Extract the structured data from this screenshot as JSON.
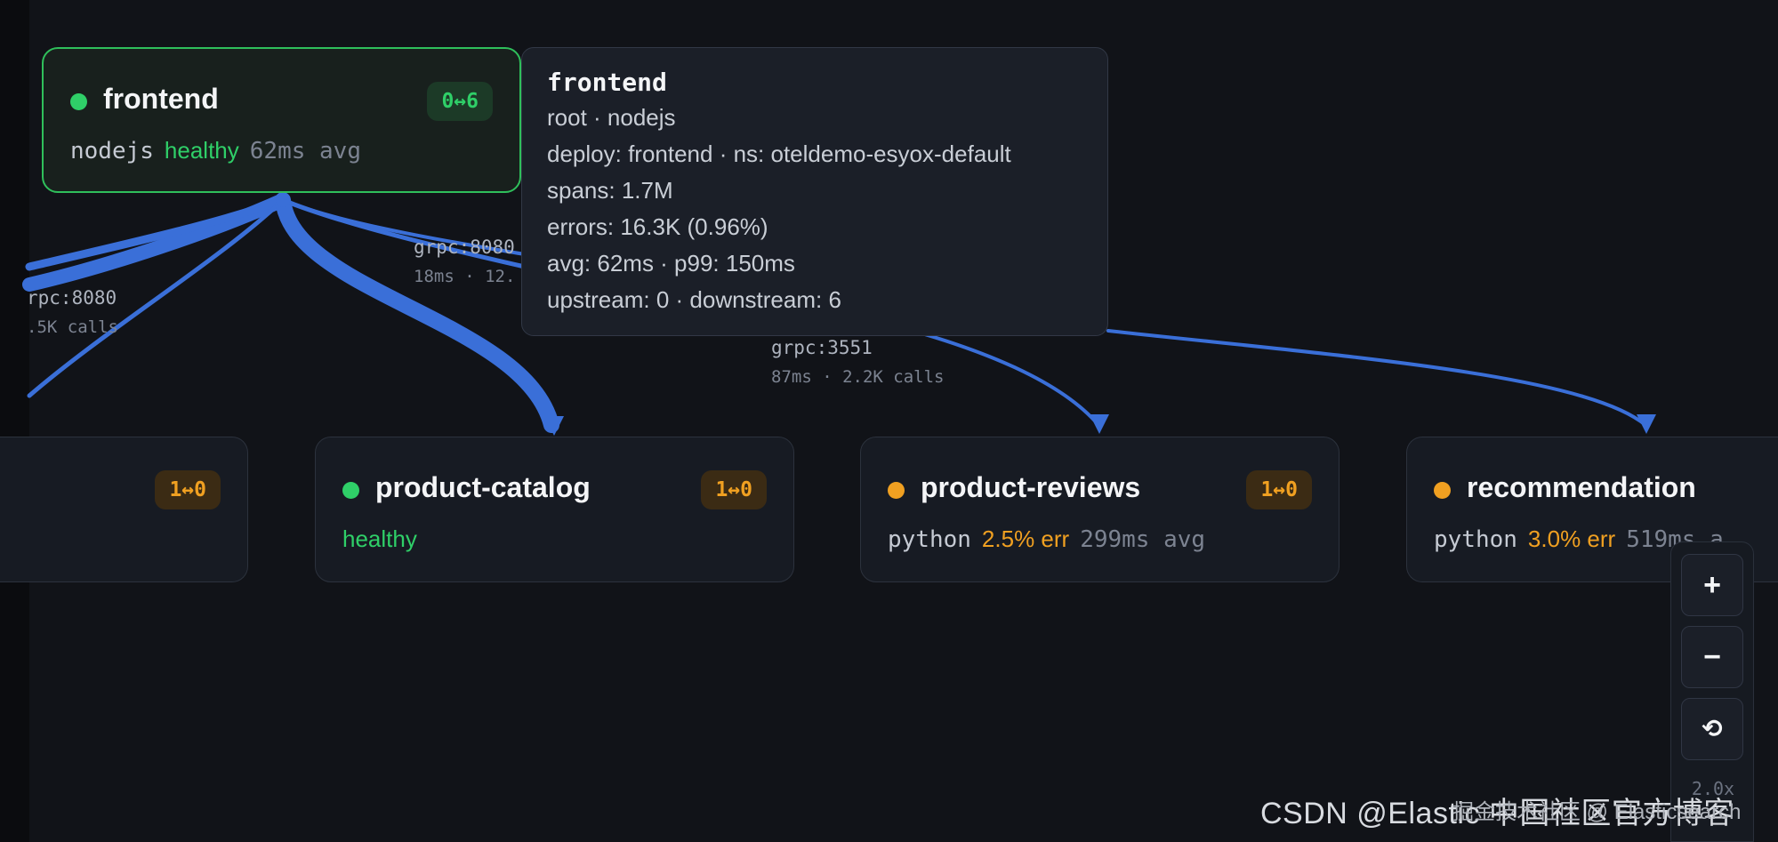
{
  "tooltip": {
    "title": "frontend",
    "lines": [
      "root · nodejs",
      "deploy: frontend · ns: oteldemo-esyox-default",
      "spans: 1.7M",
      "errors: 16.3K (0.96%)",
      "avg: 62ms · p99: 150ms",
      "upstream: 0 · downstream: 6"
    ]
  },
  "nodes": [
    {
      "name": "frontend",
      "badge": "0↔6",
      "lang": "nodejs",
      "status": "healthy",
      "latency": "62ms avg",
      "status_color": "#2fcf68"
    },
    {
      "name": "",
      "badge": "1↔0",
      "lang": "",
      "status": "",
      "latency": "",
      "status_color": "#f0a021"
    },
    {
      "name": "product-catalog",
      "badge": "1↔0",
      "lang": "",
      "status": "healthy",
      "latency": "",
      "status_color": "#2fcf68"
    },
    {
      "name": "product-reviews",
      "badge": "1↔0",
      "lang": "python",
      "status": "2.5% err",
      "latency": "299ms avg",
      "status_color": "#f0a021"
    },
    {
      "name": "recommendation",
      "badge": "1↔0",
      "lang": "python",
      "status": "3.0% err",
      "latency": "519ms a",
      "status_color": "#f0a021"
    }
  ],
  "edges": [
    {
      "proto": "rpc:8080",
      "stats": ".5K calls"
    },
    {
      "proto": "grpc:8080",
      "stats": "18ms · 12."
    },
    {
      "proto": "grpc:3551",
      "stats": "87ms · 2.2K calls"
    }
  ],
  "zoom": {
    "zoom_in": "+",
    "zoom_out": "−",
    "reset": "⟲",
    "level": "2.0x"
  },
  "watermark": {
    "csdn": "CSDN @Elastic 中国社区官方博客",
    "juejin": "掘金技术社区 @ Elasticsearch"
  },
  "colors": {
    "edge": "#3a6fd8",
    "healthy": "#2fcf68",
    "warning": "#f0a021",
    "background": "#111318"
  }
}
